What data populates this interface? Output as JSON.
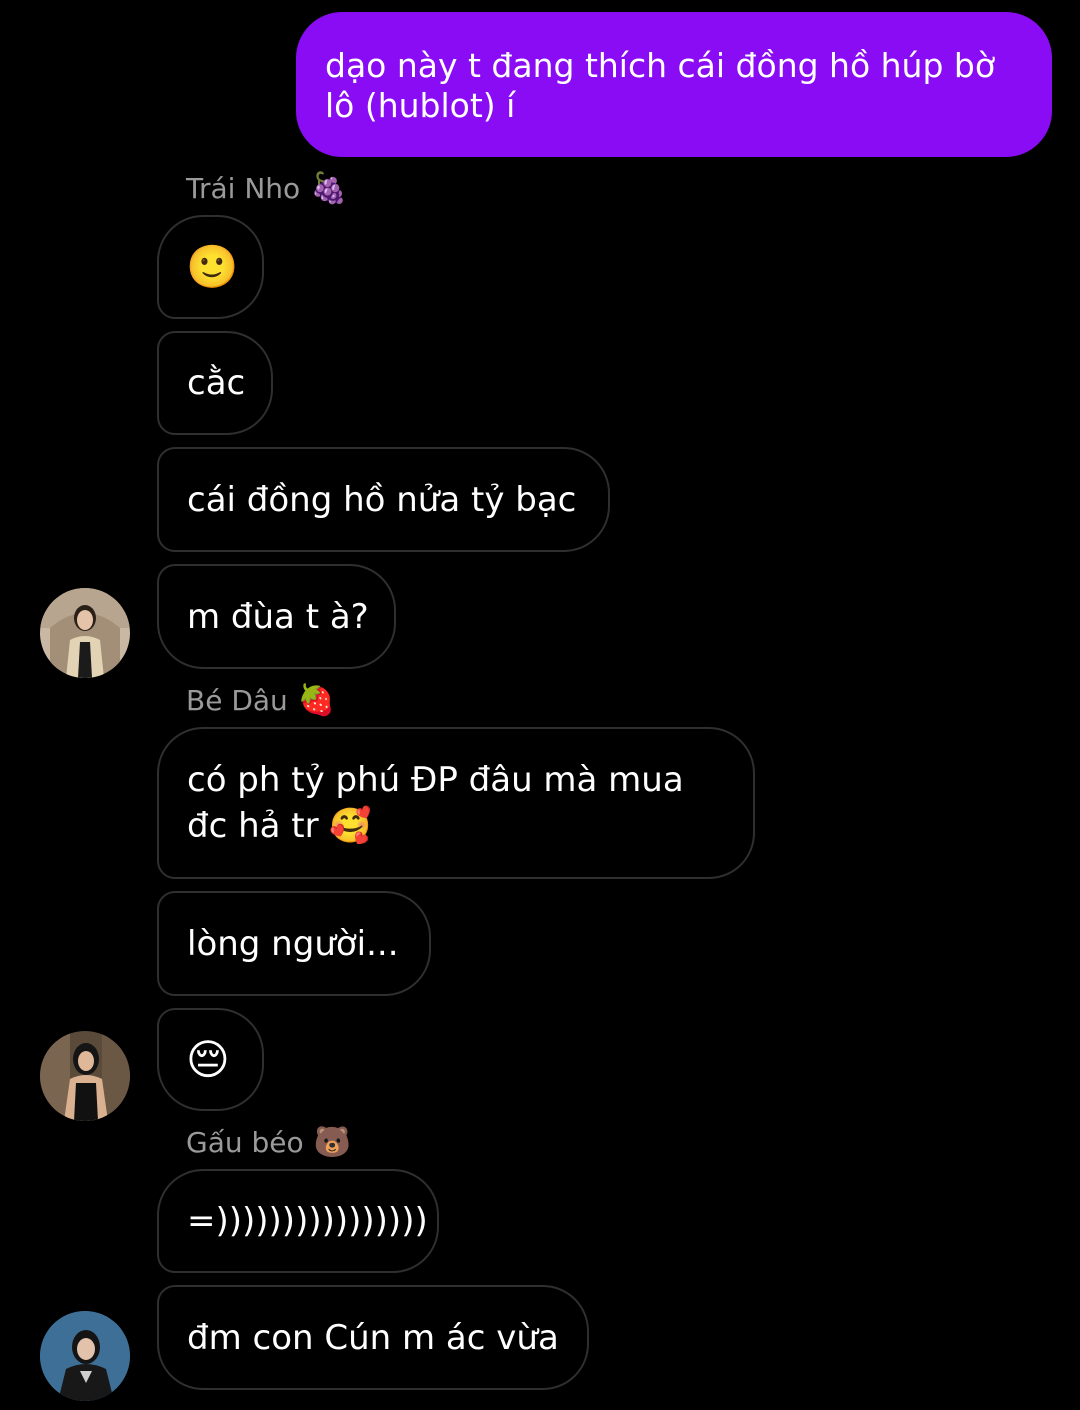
{
  "outgoing_message": "dạo này t đang thích cái đồng hồ húp bờ lô (hublot) í",
  "groups": [
    {
      "sender_name": "Trái Nho",
      "sender_emoji": "🍇",
      "messages": [
        "🙂",
        "cằc",
        "cái đồng hồ nửa tỷ bạc",
        "m đùa t à?"
      ],
      "avatar": "avatar-photo-woman-light-jacket"
    },
    {
      "sender_name": "Bé Dâu",
      "sender_emoji": "🍓",
      "messages": [
        "có ph tỷ phú ĐP đâu mà mua đc hả tr 🥰",
        "lòng người...",
        "😔"
      ],
      "avatar": "avatar-photo-woman-dark-top"
    },
    {
      "sender_name": "Gấu béo",
      "sender_emoji": "🐻",
      "messages": [
        "=))))))))))))))))",
        "đm con Cún m ác vừa"
      ],
      "avatar": "avatar-photo-woman-blue-background"
    }
  ],
  "colors": {
    "outgoing_bubble": "#8a0cf4",
    "incoming_border": "#2f2f2f",
    "sender_name": "#9a9a9a",
    "background": "#000000"
  }
}
